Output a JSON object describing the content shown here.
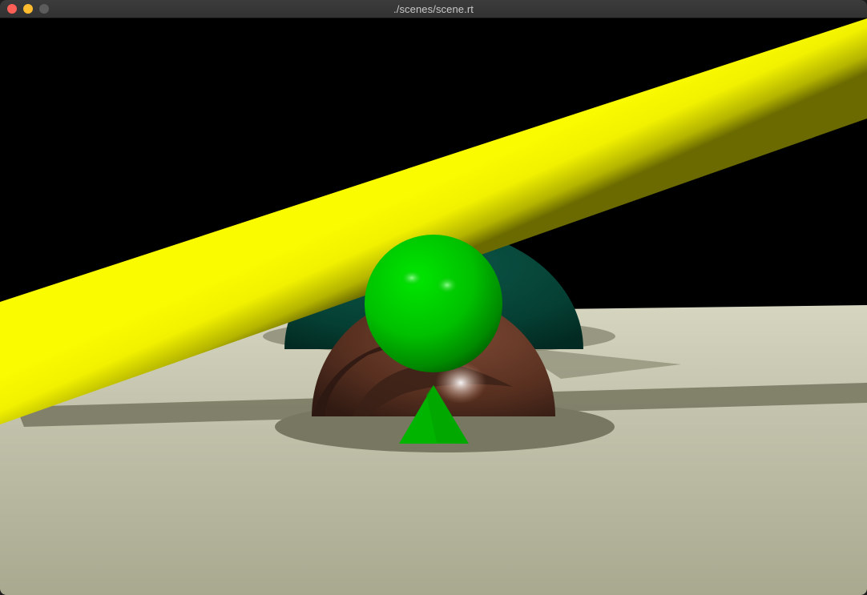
{
  "window": {
    "title": "./scenes/scene.rt"
  },
  "scene": {
    "background_color": "#000000",
    "floor_color": "#b4b49c",
    "cylinder_color": "#ffff00",
    "green_sphere_color": "#00c800",
    "dark_green_sphere_color": "#003c30",
    "brown_sphere_color": "#5a3220",
    "cone_color": "#00b400"
  }
}
